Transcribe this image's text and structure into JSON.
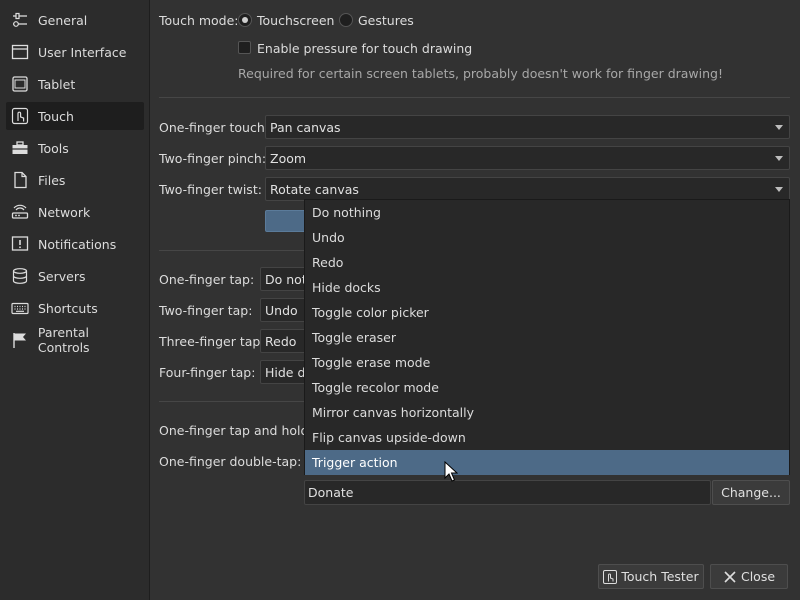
{
  "sidebar": {
    "items": [
      {
        "label": "General",
        "icon": "sliders-icon"
      },
      {
        "label": "User Interface",
        "icon": "window-icon"
      },
      {
        "label": "Tablet",
        "icon": "tablet-icon"
      },
      {
        "label": "Touch",
        "icon": "touch-icon",
        "active": true
      },
      {
        "label": "Tools",
        "icon": "toolbox-icon"
      },
      {
        "label": "Files",
        "icon": "file-icon"
      },
      {
        "label": "Network",
        "icon": "router-icon"
      },
      {
        "label": "Notifications",
        "icon": "bell-icon"
      },
      {
        "label": "Servers",
        "icon": "database-icon"
      },
      {
        "label": "Shortcuts",
        "icon": "keyboard-icon"
      },
      {
        "label": "Parental Controls",
        "icon": "flag-icon"
      }
    ]
  },
  "touch_mode": {
    "label": "Touch mode:",
    "options": [
      "Touchscreen",
      "Gestures"
    ],
    "selected": "Touchscreen"
  },
  "pressure": {
    "label": "Enable pressure for touch drawing",
    "checked": false,
    "hint": "Required for certain screen tablets, probably doesn't work for finger drawing!"
  },
  "gestures": {
    "one_finger_touch": {
      "label": "One-finger touch:",
      "value": "Pan canvas"
    },
    "two_finger_pinch": {
      "label": "Two-finger pinch:",
      "value": "Zoom"
    },
    "two_finger_twist": {
      "label": "Two-finger twist:",
      "value": "Rotate canvas"
    }
  },
  "taps": {
    "one_finger_tap": {
      "label": "One-finger tap:",
      "value": "Do not"
    },
    "two_finger_tap": {
      "label": "Two-finger tap:",
      "value": "Undo"
    },
    "three_finger_tap": {
      "label": "Three-finger tap:",
      "value": "Redo"
    },
    "four_finger_tap": {
      "label": "Four-finger tap:",
      "value": "Hide d"
    }
  },
  "holds": {
    "tap_and_hold": {
      "label": "One-finger tap and hold:"
    },
    "double_tap": {
      "label": "One-finger double-tap:"
    }
  },
  "dropdown": {
    "items": [
      "Do nothing",
      "Undo",
      "Redo",
      "Hide docks",
      "Toggle color picker",
      "Toggle eraser",
      "Toggle erase mode",
      "Toggle recolor mode",
      "Mirror canvas horizontally",
      "Flip canvas upside-down",
      "Trigger action"
    ],
    "highlighted": "Trigger action"
  },
  "action_field": {
    "value": "Donate",
    "change_label": "Change..."
  },
  "footer": {
    "touch_tester_label": "Touch Tester",
    "close_label": "Close"
  },
  "colors": {
    "highlight": "#4d6a87",
    "background": "#323232"
  }
}
